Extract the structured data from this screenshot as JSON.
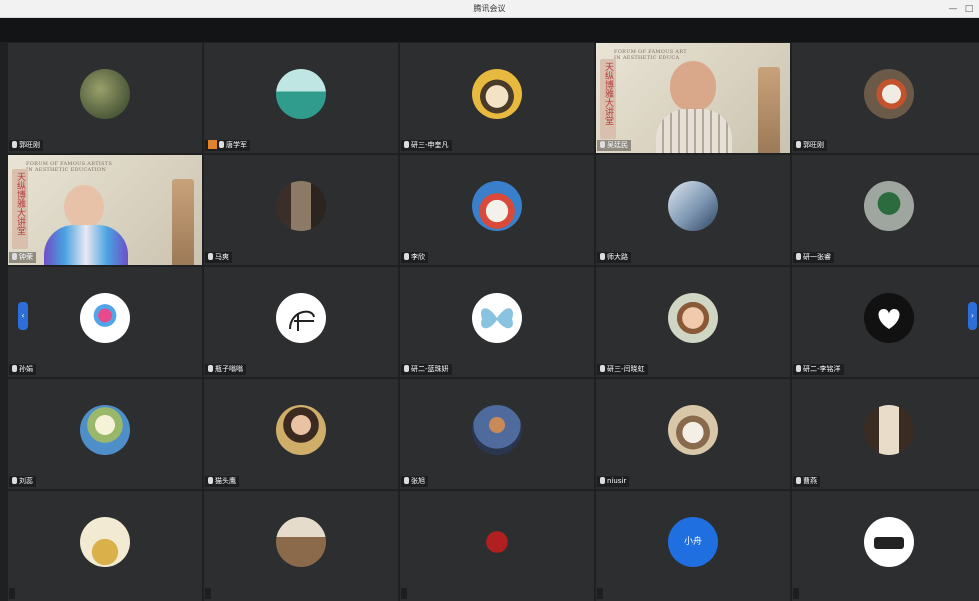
{
  "window": {
    "title": "腾讯会议",
    "min_label": "—",
    "max_label": "□"
  },
  "participants": [
    {
      "name": "郭旺刚"
    },
    {
      "name": "唐学军",
      "host": true
    },
    {
      "name": "研三-申奎凡"
    },
    {
      "name": "吴廷民",
      "video": true
    },
    {
      "name": "郭旺刚"
    },
    {
      "name": "钟荣",
      "video": true
    },
    {
      "name": "马爽"
    },
    {
      "name": "李欣"
    },
    {
      "name": "师大路"
    },
    {
      "name": "研一张睿"
    },
    {
      "name": "孙娟"
    },
    {
      "name": "瓶子嗡嗡"
    },
    {
      "name": "研二-蓝珠妍"
    },
    {
      "name": "研三-闫晓虹"
    },
    {
      "name": "研二-李铭洋"
    },
    {
      "name": "刘蕊"
    },
    {
      "name": "猫头鹰"
    },
    {
      "name": "张旭"
    },
    {
      "name": "niusir"
    },
    {
      "name": "曹燕"
    },
    {
      "name": ""
    },
    {
      "name": ""
    },
    {
      "name": ""
    },
    {
      "name": "",
      "avatar_text": "小舟"
    },
    {
      "name": ""
    }
  ],
  "nav": {
    "prev_label": "‹",
    "next_label": "›"
  },
  "colors": {
    "tile_bg": "#2d2e30",
    "accent": "#2d6ed8",
    "host_badge": "#e0832c"
  }
}
